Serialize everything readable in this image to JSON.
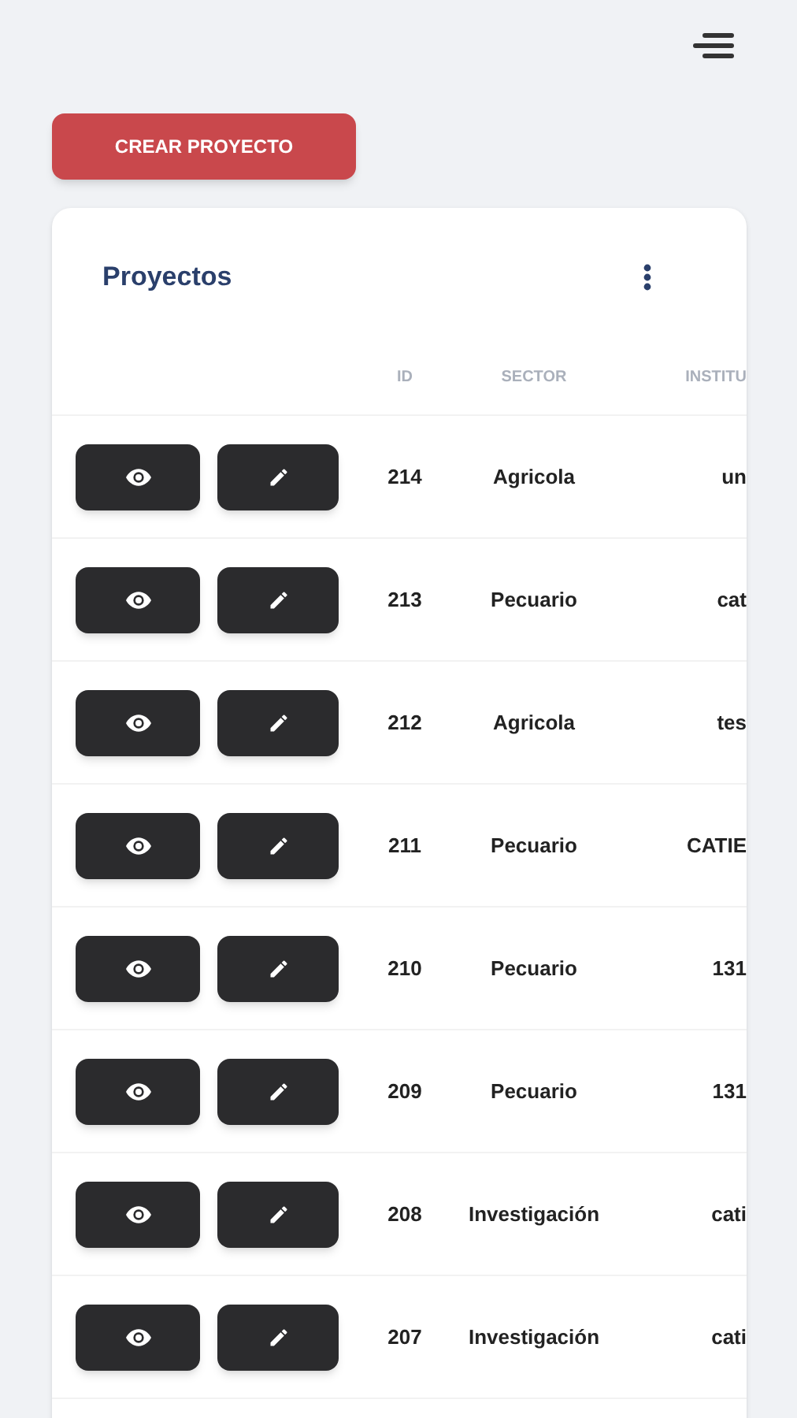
{
  "create_button": "CREAR PROYECTO",
  "card": {
    "title": "Proyectos"
  },
  "table": {
    "columns": [
      "ID",
      "SECTOR",
      "INSTITU"
    ],
    "rows": [
      {
        "id": "214",
        "sector": "Agricola",
        "column_3": "un"
      },
      {
        "id": "213",
        "sector": "Pecuario",
        "column_3": "cat"
      },
      {
        "id": "212",
        "sector": "Agricola",
        "column_3": "tes"
      },
      {
        "id": "211",
        "sector": "Pecuario",
        "column_3": "CATIE"
      },
      {
        "id": "210",
        "sector": "Pecuario",
        "column_3": "131"
      },
      {
        "id": "209",
        "sector": "Pecuario",
        "column_3": "131"
      },
      {
        "id": "208",
        "sector": "Investigación",
        "column_3": "cati"
      },
      {
        "id": "207",
        "sector": "Investigación",
        "column_3": "cati"
      }
    ]
  }
}
